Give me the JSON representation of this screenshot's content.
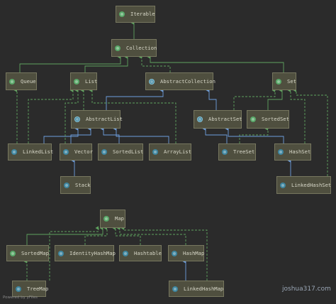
{
  "nodes": {
    "iterable": {
      "label": "Iterable",
      "kind": "interface"
    },
    "collection": {
      "label": "Collection",
      "kind": "interface"
    },
    "queue": {
      "label": "Queue",
      "kind": "interface"
    },
    "list": {
      "label": "List",
      "kind": "interface"
    },
    "abstract_collection": {
      "label": "AbstractCollection",
      "kind": "abstract"
    },
    "set": {
      "label": "Set",
      "kind": "interface"
    },
    "abstract_list": {
      "label": "AbstractList",
      "kind": "abstract"
    },
    "abstract_set": {
      "label": "AbstractSet",
      "kind": "abstract"
    },
    "sorted_set": {
      "label": "SortedSet",
      "kind": "interface"
    },
    "linked_list": {
      "label": "LinkedList",
      "kind": "class"
    },
    "vector": {
      "label": "Vector",
      "kind": "class"
    },
    "sorted_list": {
      "label": "SortedList",
      "kind": "class"
    },
    "array_list": {
      "label": "ArrayList",
      "kind": "class"
    },
    "tree_set": {
      "label": "TreeSet",
      "kind": "class"
    },
    "hash_set": {
      "label": "HashSet",
      "kind": "class"
    },
    "stack": {
      "label": "Stack",
      "kind": "class"
    },
    "linked_hash_set": {
      "label": "LinkedHashSet",
      "kind": "class"
    },
    "map": {
      "label": "Map",
      "kind": "interface"
    },
    "sorted_map": {
      "label": "SortedMap",
      "kind": "interface"
    },
    "identity_hash_map": {
      "label": "IdentityHashMap",
      "kind": "class"
    },
    "hashtable": {
      "label": "Hashtable",
      "kind": "class"
    },
    "hash_map": {
      "label": "HashMap",
      "kind": "class"
    },
    "tree_map": {
      "label": "TreeMap",
      "kind": "class"
    },
    "linked_hash_map": {
      "label": "LinkedHashMap",
      "kind": "class"
    }
  },
  "colors": {
    "background": "#2b2b2b",
    "node_fill": "#4f4f3f",
    "node_border": "#77775f",
    "extends_edge": "#6e9fdf",
    "implements_edge": "#5fa35f"
  },
  "footer": {
    "left": "Powered by yFiles",
    "right": "joshua317.com"
  }
}
